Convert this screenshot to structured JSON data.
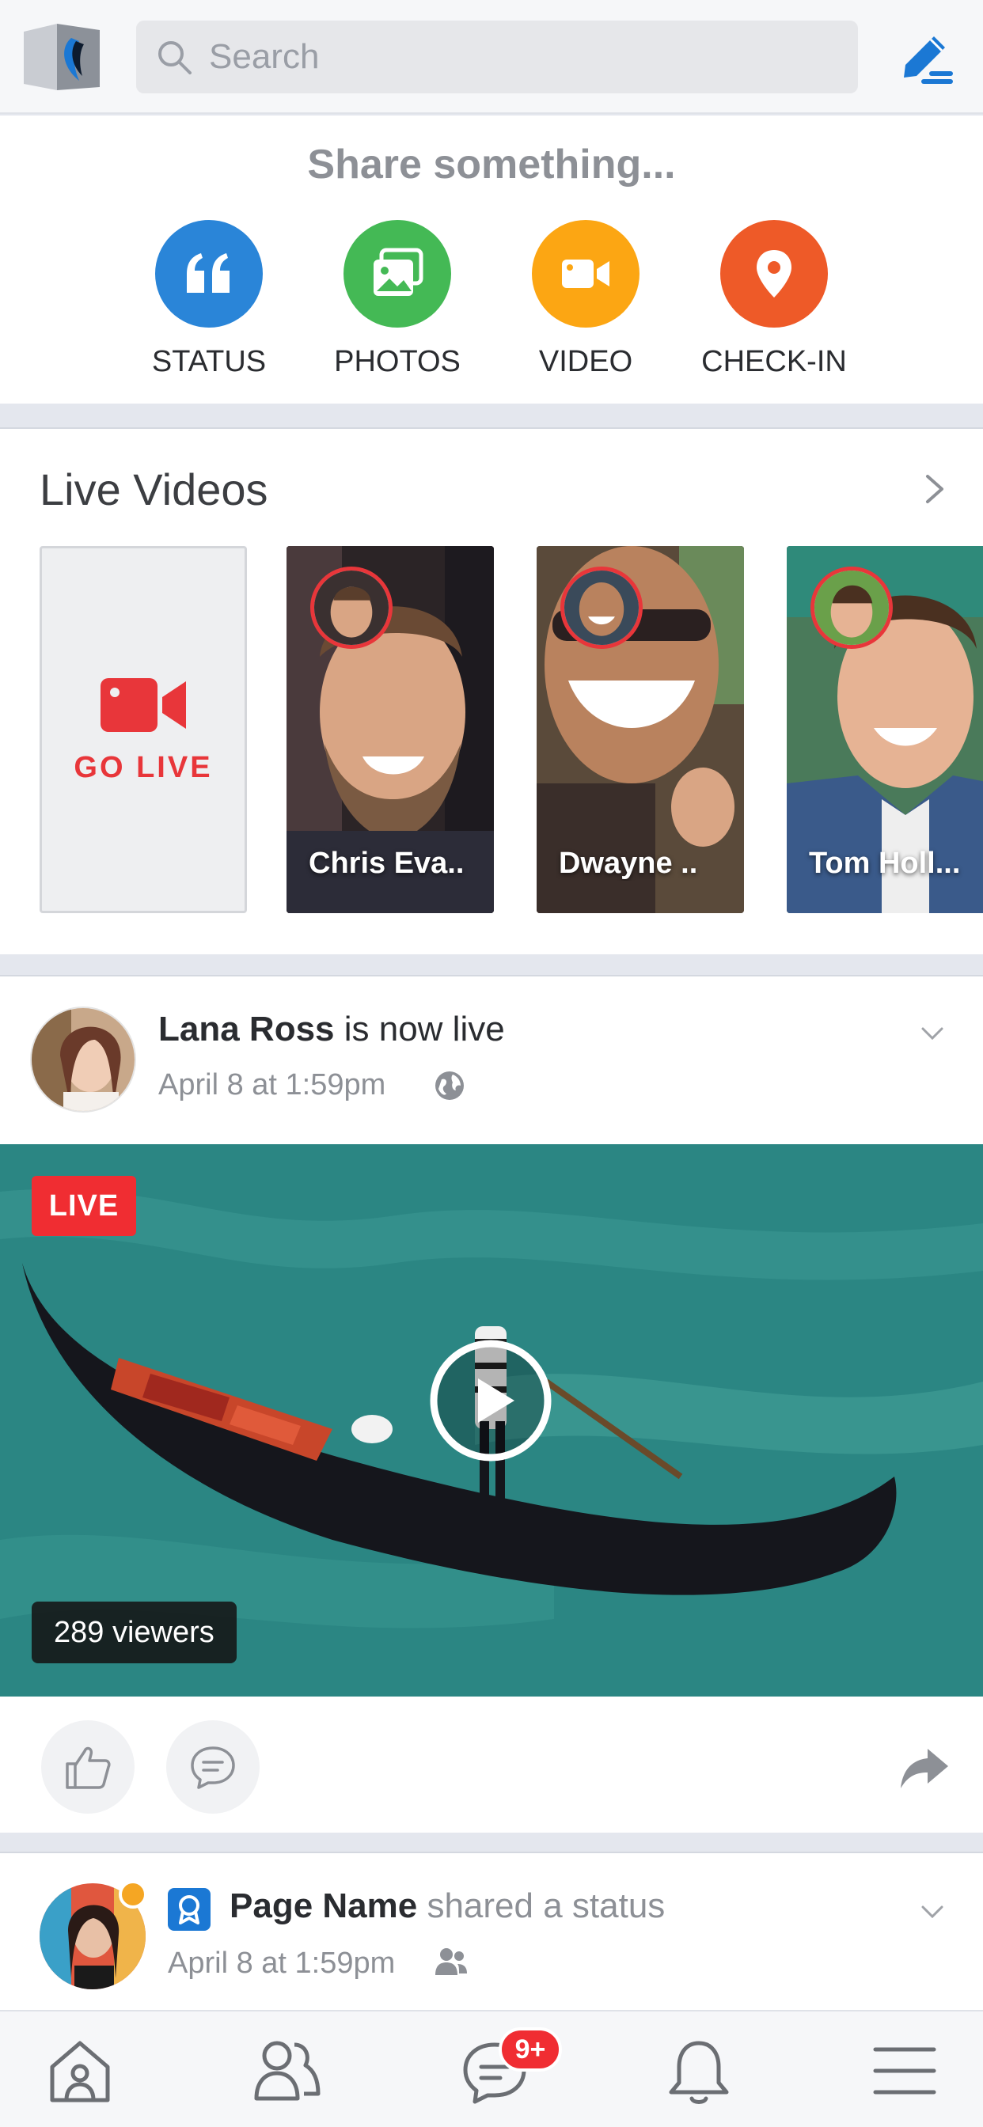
{
  "header": {
    "search_placeholder": "Search",
    "icons": [
      "app-logo",
      "search-icon",
      "compose-icon"
    ],
    "accent_color": "#1b78d4"
  },
  "share": {
    "title": "Share something...",
    "items": [
      {
        "label": "STATUS",
        "icon": "quote-icon",
        "color": "#2a85d8"
      },
      {
        "label": "PHOTOS",
        "icon": "photos-icon",
        "color": "#44b955"
      },
      {
        "label": "VIDEO",
        "icon": "video-camera-icon",
        "color": "#fca613"
      },
      {
        "label": "CHECK-IN",
        "icon": "location-pin-icon",
        "color": "#ee5a28"
      }
    ]
  },
  "live_videos": {
    "title": "Live Videos",
    "go_live_label": "GO LIVE",
    "items": [
      {
        "name": "Chris Eva.."
      },
      {
        "name": "Dwayne .."
      },
      {
        "name": "Tom Holl..."
      }
    ]
  },
  "post1": {
    "author": "Lana Ross",
    "action": " is now live",
    "timestamp": "April 8 at 1:59pm",
    "privacy_icon": "globe-icon",
    "live_badge": "LIVE",
    "viewers": "289 viewers",
    "live_color": "#f02d32"
  },
  "post2": {
    "author": "Page Name",
    "action": " shared a status",
    "timestamp": "April 8 at 1:59pm",
    "privacy_icon": "friends-icon"
  },
  "tabbar": {
    "items": [
      "home-icon",
      "friends-icon",
      "messages-icon",
      "notifications-icon",
      "menu-icon"
    ],
    "messages_badge": "9+"
  }
}
